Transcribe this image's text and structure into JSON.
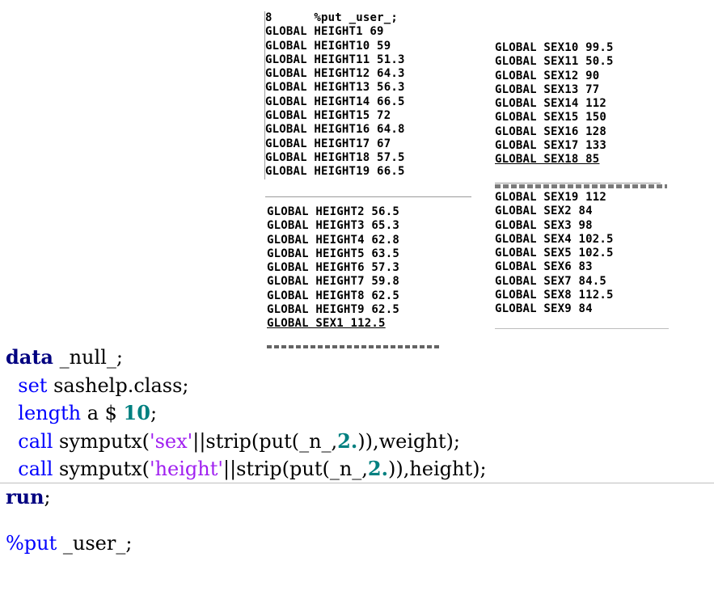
{
  "log_top": {
    "header_number": "8",
    "header_stmt": "%put _user_;",
    "lines": [
      "GLOBAL HEIGHT1 69",
      "GLOBAL HEIGHT10 59",
      "GLOBAL HEIGHT11 51.3",
      "GLOBAL HEIGHT12 64.3",
      "GLOBAL HEIGHT13 56.3",
      "GLOBAL HEIGHT14 66.5",
      "GLOBAL HEIGHT15 72",
      "GLOBAL HEIGHT16 64.8",
      "GLOBAL HEIGHT17 67",
      "GLOBAL HEIGHT18 57.5",
      "GLOBAL HEIGHT19 66.5"
    ]
  },
  "log_bottom_left": {
    "lines": [
      "GLOBAL HEIGHT2 56.5",
      "GLOBAL HEIGHT3 65.3",
      "GLOBAL HEIGHT4 62.8",
      "GLOBAL HEIGHT5 63.5",
      "GLOBAL HEIGHT6 57.3",
      "GLOBAL HEIGHT7 59.8",
      "GLOBAL HEIGHT8 62.5",
      "GLOBAL HEIGHT9 62.5",
      "GLOBAL SEX1 112.5"
    ]
  },
  "log_top_right": {
    "lines": [
      "GLOBAL SEX10 99.5",
      "GLOBAL SEX11 50.5",
      "GLOBAL SEX12 90",
      "GLOBAL SEX13 77",
      "GLOBAL SEX14 112",
      "GLOBAL SEX15 150",
      "GLOBAL SEX16 128",
      "GLOBAL SEX17 133",
      "GLOBAL SEX18 85"
    ]
  },
  "log_bottom_right": {
    "lines": [
      "GLOBAL SEX19 112",
      "GLOBAL SEX2 84",
      "GLOBAL SEX3 98",
      "GLOBAL SEX4 102.5",
      "GLOBAL SEX5 102.5",
      "GLOBAL SEX6 83",
      "GLOBAL SEX7 84.5",
      "GLOBAL SEX8 112.5",
      "GLOBAL SEX9 84"
    ]
  },
  "editor": {
    "l1_kw": "data",
    "l1_rest": " _null_;",
    "l2_kw": "set",
    "l2_rest": " sashelp.class;",
    "l3_kw": "length",
    "l3_mid": " a $ ",
    "l3_num": "10",
    "l3_end": ";",
    "l4_kw": "call",
    "l4_a": " symputx(",
    "l4_str": "'sex'",
    "l4_b": "||strip(put(_n_,",
    "l4_num": "2.",
    "l4_c": ")),weight);",
    "l5_kw": "call",
    "l5_a": " symputx(",
    "l5_str": "'height'",
    "l5_b": "||strip(put(_n_,",
    "l5_num": "2.",
    "l5_c": ")),height);",
    "l6_kw": "run",
    "l6_end": ";",
    "l7_macro": "%put",
    "l7_rest": " _user_;"
  },
  "colors": {
    "step_keyword": "#000080",
    "statement_keyword": "#0000ff",
    "string": "#a020f0",
    "number": "#008080"
  }
}
